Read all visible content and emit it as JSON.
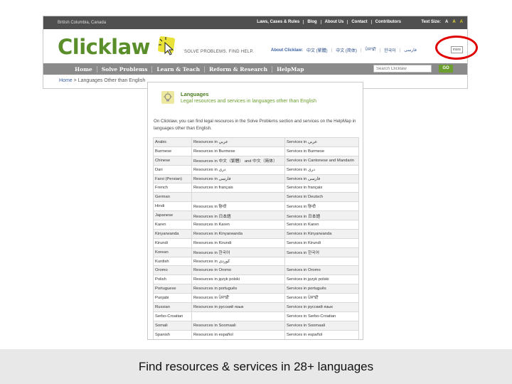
{
  "site": {
    "region": "British Columbia, Canada",
    "top_links": [
      "Laws, Cases & Rules",
      "Blog",
      "About Us",
      "Contact",
      "Contributors"
    ],
    "text_size_label": "Text Size:",
    "text_sizes": [
      "A",
      "A",
      "A"
    ],
    "logo": "Clicklaw",
    "tagline": "SOLVE PROBLEMS. FIND HELP.",
    "about_label": "About Clicklaw:",
    "languages": [
      "中文 (繁體)",
      "中文 (简体)",
      "ਪੰਜਾਬੀ",
      "한국어",
      "فارسی"
    ],
    "more_label": "more",
    "nav": [
      "Home",
      "Solve Problems",
      "Learn & Teach",
      "Reform & Research",
      "HelpMap"
    ],
    "search_placeholder": "Search Clicklaw",
    "search_button": "GO",
    "breadcrumb": [
      "Home",
      "Languages Other than English"
    ],
    "highlight_color": "#e00000"
  },
  "panel": {
    "title": "Languages",
    "subtitle": "Legal resources and services in languages other than English",
    "intro": "On Clicklaw, you can find legal resources in the Solve Problems section and services on the HelpMap in languages other than English.",
    "rows": [
      {
        "lang": "Arabic",
        "resources": "Resources in عربي",
        "services": "Services in عربي"
      },
      {
        "lang": "Burmese",
        "resources": "Resources in Burmese",
        "services": "Services in Burmese"
      },
      {
        "lang": "Chinese",
        "resources": "Resources in 中文（繁體） and 中文（简体）",
        "services": "Services in Cantonese and Mandarin"
      },
      {
        "lang": "Dari",
        "resources": "Resources in دری",
        "services": "Services in دری"
      },
      {
        "lang": "Farsi (Persian)",
        "resources": "Resources in فارسی",
        "services": "Services in فارسی"
      },
      {
        "lang": "French",
        "resources": "Resources in français",
        "services": "Services in français"
      },
      {
        "lang": "German",
        "resources": "",
        "services": "Services in Deutsch"
      },
      {
        "lang": "Hindi",
        "resources": "Resources in हिन्दी",
        "services": "Services in हिन्दी"
      },
      {
        "lang": "Japanese",
        "resources": "Resources in 日本語",
        "services": "Services in 日本語"
      },
      {
        "lang": "Karen",
        "resources": "Resources in Karen",
        "services": "Services in Karen"
      },
      {
        "lang": "Kinyarwanda",
        "resources": "Resources in Kinyarwanda",
        "services": "Services in Kinyarwanda"
      },
      {
        "lang": "Kirundi",
        "resources": "Resources in Kirundi",
        "services": "Services in Kirundi"
      },
      {
        "lang": "Korean",
        "resources": "Resources in 한국어",
        "services": "Services in 한국어"
      },
      {
        "lang": "Kurdish",
        "resources": "Resources in کوردی",
        "services": ""
      },
      {
        "lang": "Oromo",
        "resources": "Resources in Oromo",
        "services": "Services in Oromo"
      },
      {
        "lang": "Polish",
        "resources": "Resources in język polski",
        "services": "Services in język polski"
      },
      {
        "lang": "Portuguese",
        "resources": "Resources in português",
        "services": "Services in português"
      },
      {
        "lang": "Punjabi",
        "resources": "Resources in ਪੰਜਾਬੀ",
        "services": "Services in ਪੰਜਾਬੀ"
      },
      {
        "lang": "Russian",
        "resources": "Resources in русский язык",
        "services": "Services in русский язык"
      },
      {
        "lang": "Serbo-Croatian",
        "resources": "",
        "services": "Services in Serbo-Croatian"
      },
      {
        "lang": "Somali",
        "resources": "Resources in Soomaali",
        "services": "Services in Soomaali"
      },
      {
        "lang": "Spanish",
        "resources": "Resources in español",
        "services": "Services in español"
      }
    ]
  },
  "caption": "Find resources & services in 28+ languages"
}
